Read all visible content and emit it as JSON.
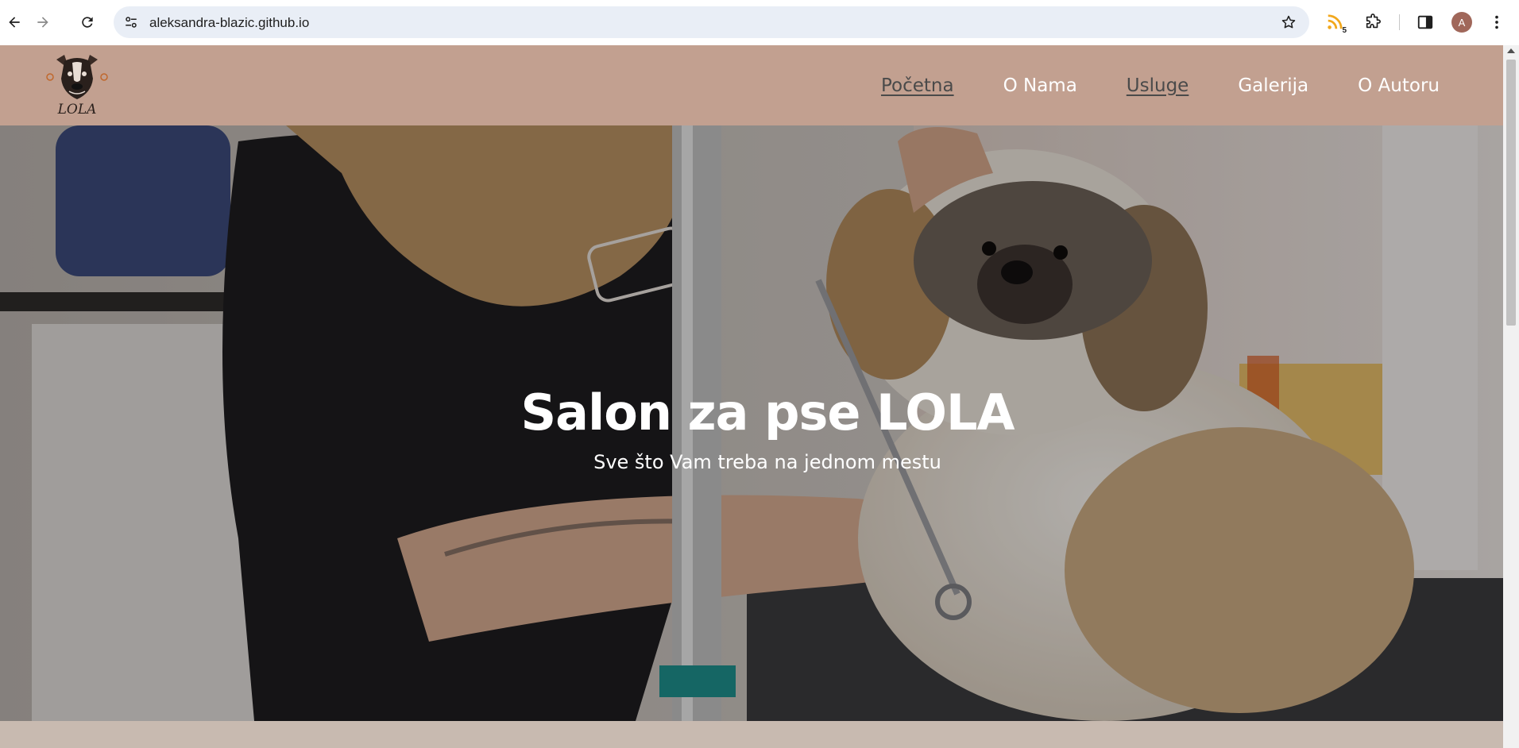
{
  "browser": {
    "url": "aleksandra-blazic.github.io",
    "extension_badge": "5",
    "profile_initial": "A"
  },
  "site": {
    "logo_text": "LOLA",
    "nav": [
      {
        "label": "Početna",
        "underlined": true
      },
      {
        "label": "O Nama",
        "underlined": false
      },
      {
        "label": "Usluge",
        "underlined": true
      },
      {
        "label": "Galerija",
        "underlined": false
      },
      {
        "label": "O Autoru",
        "underlined": false
      }
    ],
    "hero": {
      "title": "Salon za pse LOLA",
      "subtitle": "Sve što Vam treba na jednom mestu"
    }
  },
  "colors": {
    "header_bg": "#c2a090",
    "omnibox_bg": "#e9eef6",
    "below_hero_bg": "#c8bab0"
  },
  "icons": [
    "back-icon",
    "forward-icon",
    "reload-icon",
    "site-info-icon",
    "bookmark-star-icon",
    "rss-extension-icon",
    "extensions-puzzle-icon",
    "side-panel-icon",
    "kebab-menu-icon"
  ]
}
